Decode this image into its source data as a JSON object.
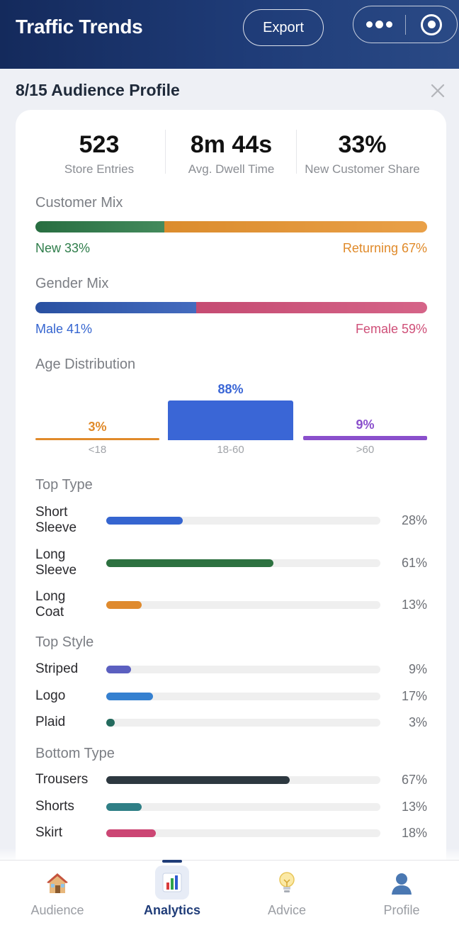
{
  "header": {
    "title": "Traffic Trends",
    "export_label": "Export"
  },
  "sheet": {
    "title": "8/15 Audience Profile"
  },
  "stats": [
    {
      "value": "523",
      "label": "Store Entries"
    },
    {
      "value": "8m 44s",
      "label": "Avg. Dwell Time"
    },
    {
      "value": "33%",
      "label": "New Customer Share"
    }
  ],
  "customer_mix": {
    "title": "Customer Mix",
    "left_label": "New 33%",
    "right_label": "Returning 67%",
    "left_share": 0.33,
    "right_share": 0.67,
    "left_color": "#2e7d4a",
    "right_color": "#e6932f"
  },
  "gender_mix": {
    "title": "Gender Mix",
    "left_label": "Male 41%",
    "right_label": "Female 59%",
    "left_share": 0.41,
    "right_share": 0.59,
    "left_color": "#2f5bb7",
    "right_color": "#cf4f78"
  },
  "age": {
    "title": "Age Distribution",
    "groups": [
      {
        "label": "<18",
        "value_label": "3%",
        "value": 3,
        "color": "#e08a2a"
      },
      {
        "label": "18-60",
        "value_label": "88%",
        "value": 88,
        "color": "#3a66d6"
      },
      {
        "label": ">60",
        "value_label": "9%",
        "value": 9,
        "color": "#8a4fcc"
      }
    ]
  },
  "top_type": {
    "title": "Top Type",
    "rows": [
      {
        "label": "Short Sleeve",
        "value_label": "28%",
        "value": 28,
        "color": "#3565d0"
      },
      {
        "label": "Long Sleeve",
        "value_label": "61%",
        "value": 61,
        "color": "#2d7140"
      },
      {
        "label": "Long Coat",
        "value_label": "13%",
        "value": 13,
        "color": "#df8a2e"
      }
    ]
  },
  "top_style": {
    "title": "Top Style",
    "rows": [
      {
        "label": "Striped",
        "value_label": "9%",
        "value": 9,
        "color": "#5b5fc0"
      },
      {
        "label": "Logo",
        "value_label": "17%",
        "value": 17,
        "color": "#3580d0"
      },
      {
        "label": "Plaid",
        "value_label": "3%",
        "value": 3,
        "color": "#246b5e"
      }
    ]
  },
  "bottom_type": {
    "title": "Bottom Type",
    "rows": [
      {
        "label": "Trousers",
        "value_label": "67%",
        "value": 67,
        "color": "#2d3840"
      },
      {
        "label": "Shorts",
        "value_label": "13%",
        "value": 13,
        "color": "#2f7f86"
      },
      {
        "label": "Skirt",
        "value_label": "18%",
        "value": 18,
        "color": "#cc4674"
      }
    ]
  },
  "tabs": [
    {
      "label": "Audience",
      "icon": "house-icon"
    },
    {
      "label": "Analytics",
      "icon": "bar-chart-icon",
      "active": true
    },
    {
      "label": "Advice",
      "icon": "lightbulb-icon"
    },
    {
      "label": "Profile",
      "icon": "person-icon"
    }
  ]
}
